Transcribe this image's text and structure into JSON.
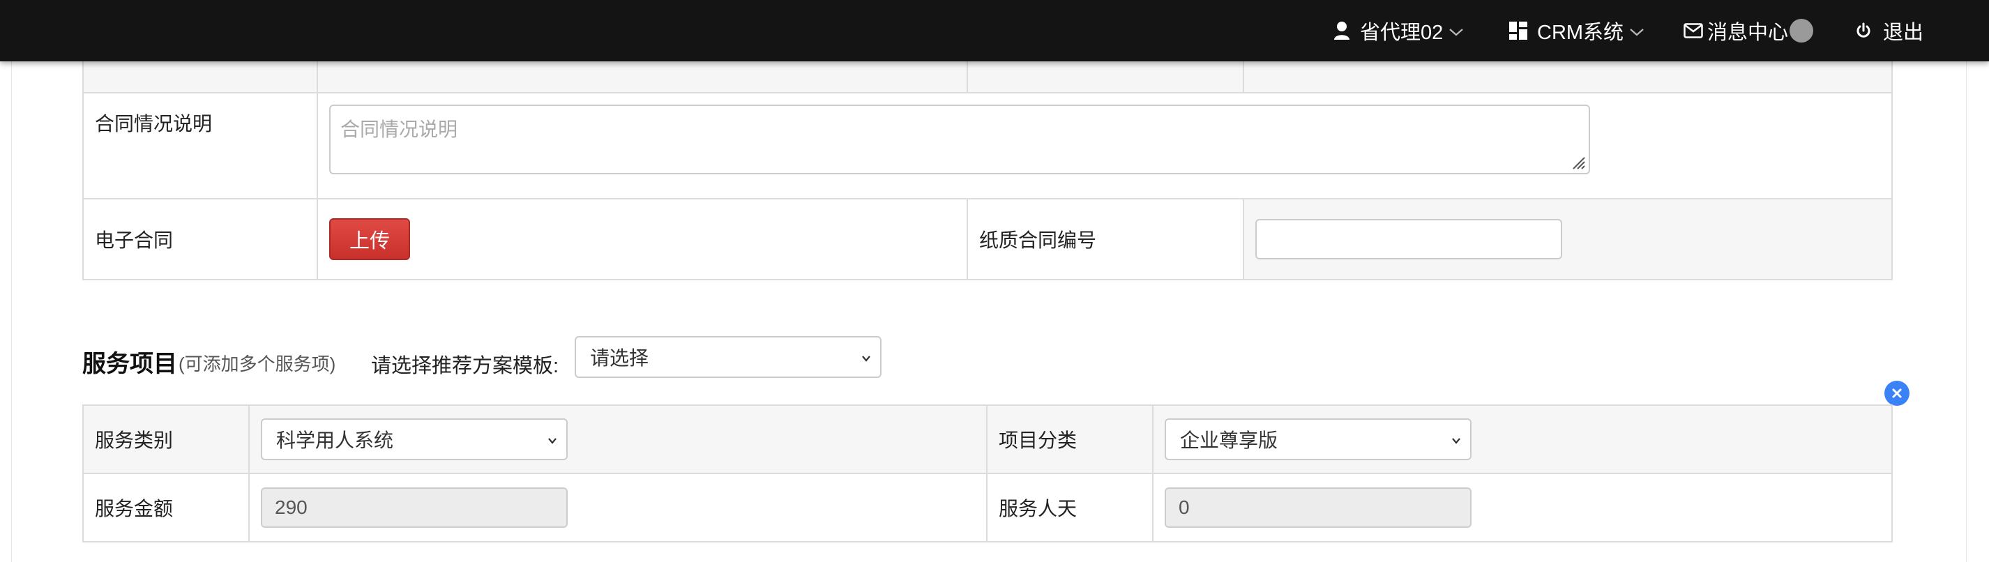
{
  "navbar": {
    "user_label": "省代理02",
    "crm_label": "CRM系统",
    "message_label": "消息中心",
    "logout_label": "退出"
  },
  "contract_form": {
    "description_label": "合同情况说明",
    "description_placeholder": "合同情况说明",
    "econtract_label": "电子合同",
    "upload_button": "上传",
    "paper_number_label": "纸质合同编号",
    "paper_number_value": ""
  },
  "services": {
    "title": "服务项目",
    "note": "(可添加多个服务项)",
    "template_label": "请选择推荐方案模板:",
    "template_selected": "请选择",
    "category_label": "服务类别",
    "category_selected": "科学用人系统",
    "project_type_label": "项目分类",
    "project_type_selected": "企业尊享版",
    "amount_label": "服务金额",
    "amount_value": "290",
    "days_label": "服务人天",
    "days_value": "0"
  },
  "colors": {
    "navbar_bg": "#141414",
    "upload_button": "#d9534f",
    "remove_button": "#3b82f6"
  },
  "icons": {
    "user": "user-icon",
    "crm": "dashboard-grid-icon",
    "message": "envelope-icon",
    "logout": "power-icon",
    "remove": "close-circle-icon"
  }
}
